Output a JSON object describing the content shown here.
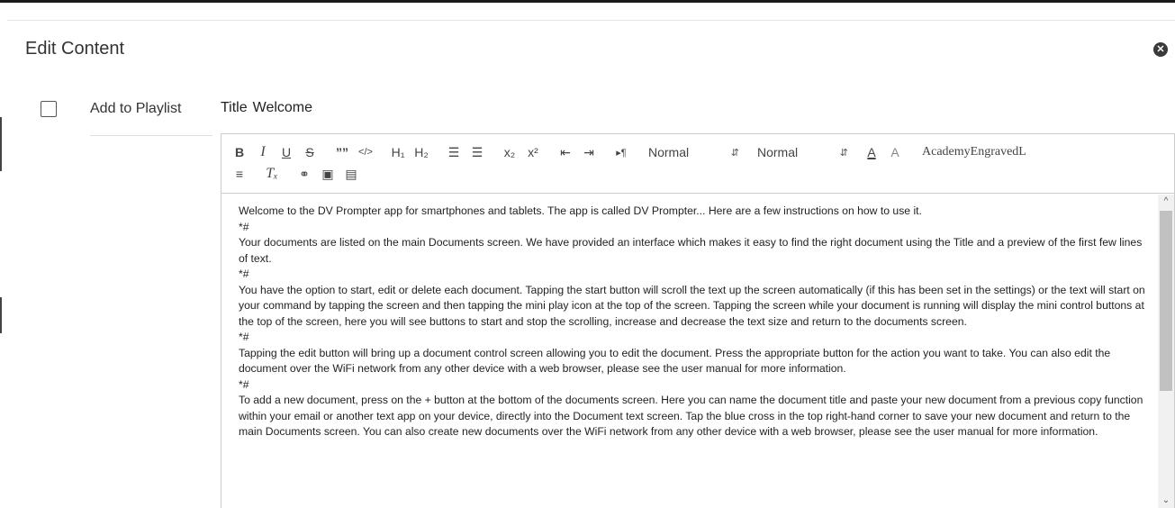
{
  "modal": {
    "title": "Edit Content",
    "close_glyph": "✕"
  },
  "playlist": {
    "label": "Add to Playlist",
    "checked": false
  },
  "title_field": {
    "label": "Title",
    "value": "Welcome"
  },
  "toolbar": {
    "row1": {
      "bold": "B",
      "italic": "I",
      "underline": "U",
      "strike": "S",
      "blockquote": "””",
      "code": "</>",
      "h1": "H₁",
      "h2": "H₂",
      "ordered_list": "☰",
      "bullet_list": "☰",
      "subscript": "x₂",
      "superscript": "x²",
      "outdent": "⇤",
      "indent": "⇥",
      "direction": "▸¶",
      "size_picker": "Normal",
      "header_picker": "Normal",
      "color": "A",
      "background": "A",
      "font_picker": "AcademyEngravedLET"
    },
    "row2": {
      "align": "≡",
      "clean": "Tₓ",
      "link": "⚭",
      "image": "▣",
      "video": "▤"
    }
  },
  "content": {
    "paragraphs": [
      "Welcome to the DV Prompter app for smartphones and tablets. The app is called DV Prompter... Here are a few instructions on how to use it.",
      "*#",
      "Your documents are listed on the main Documents screen. We have provided an interface which makes it easy to find the right document using the Title and a preview of the first few lines of text.",
      "*#",
      "You have the option to start, edit or delete each document. Tapping the start button will scroll the text up the screen automatically (if this has been set in the settings) or the text will start on your command by tapping the screen and then tapping the mini play icon at the top of the screen. Tapping the screen while your document is running will display the mini control buttons at the top of the screen, here you will see buttons to start and stop the scrolling, increase and decrease the text size and return to the documents screen.",
      "*#",
      "Tapping the edit button will bring up a document control screen allowing you to edit the document. Press the appropriate button for the action you want to take. You can also edit the document over the WiFi network from any other device with a web browser, please see the user manual for more information.",
      "*#",
      "To add a new document, press on the + button at the bottom of the documents screen. Here you can name the document title and paste your new document from a previous copy function within your email or another text app on your device, directly into the Document text screen. Tap the blue cross in the top right-hand corner to save your new document and return to the main Documents screen. You can also create new documents over the WiFi network from any other device with a web browser, please see the user manual for more information."
    ]
  },
  "scrollbar": {
    "up_glyph": "^",
    "down_glyph": "⌄"
  }
}
